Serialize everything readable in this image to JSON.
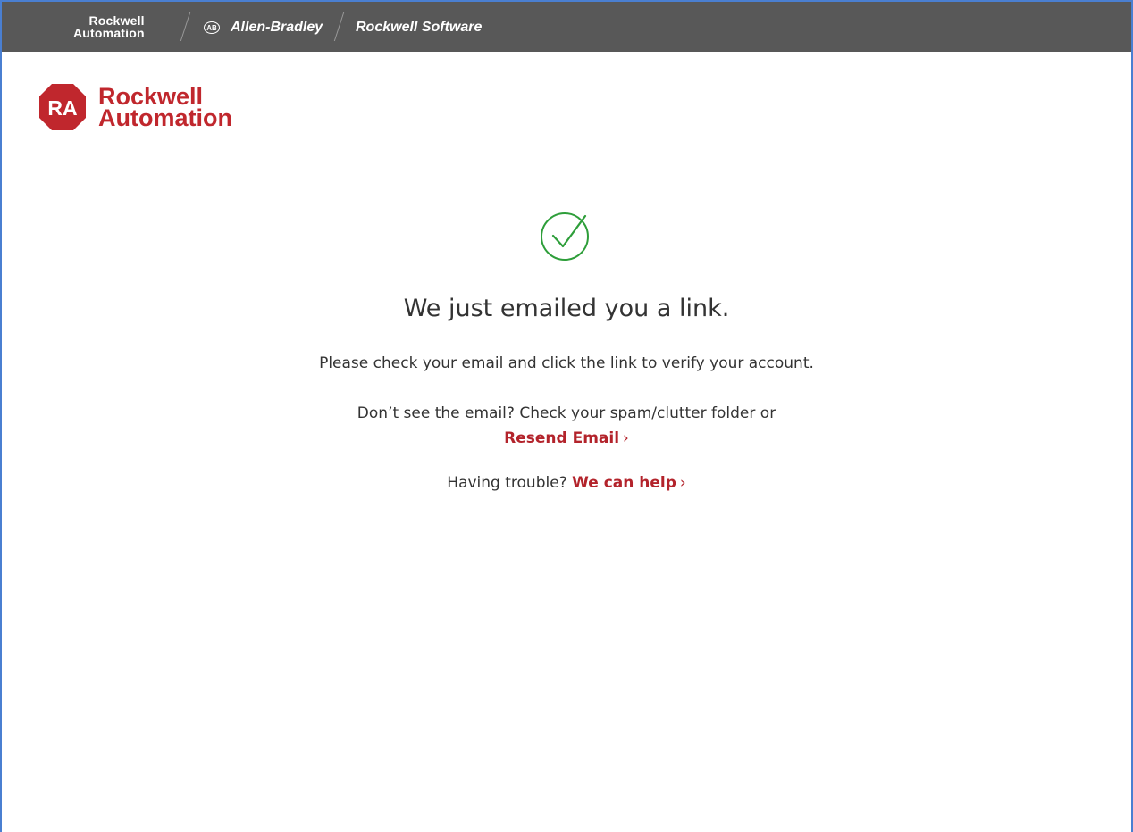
{
  "topbar": {
    "brand_ra_line1": "Rockwell",
    "brand_ra_line2": "Automation",
    "ab_badge": "AB",
    "brand_ab": "Allen-Bradley",
    "brand_rs": "Rockwell Software",
    "background": "#585858"
  },
  "logo": {
    "mark_text": "RA",
    "line1": "Rockwell",
    "line2": "Automation",
    "color": "#c0272d"
  },
  "confirmation": {
    "icon": "check-circle-icon",
    "icon_color": "#2e9e3a",
    "heading": "We just emailed you a link.",
    "message": "Please check your email and click the link to verify your account.",
    "spam_text": "Don’t see the email? Check your spam/clutter folder or",
    "resend_link": "Resend Email",
    "trouble_text": "Having trouble?",
    "help_link": "We can help",
    "chevron": "›",
    "link_color": "#b3232b"
  }
}
